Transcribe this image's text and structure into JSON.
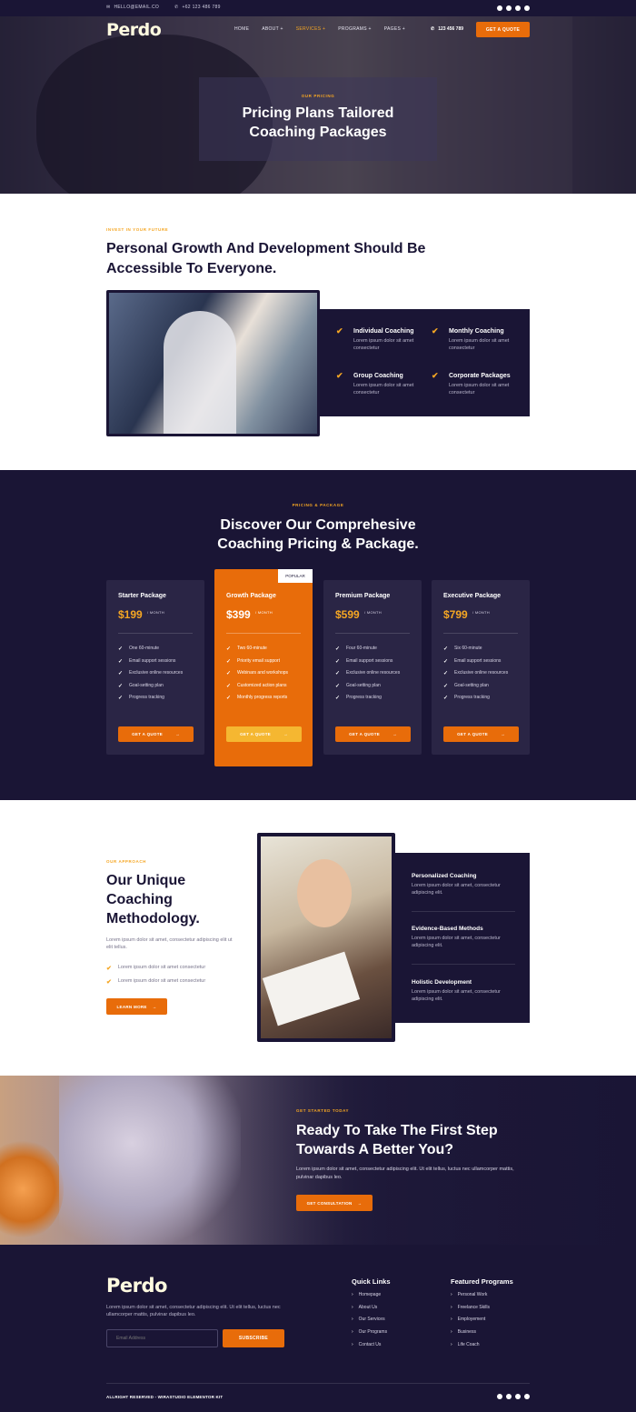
{
  "topbar": {
    "email": "HELLO@EMAIL.CO",
    "phone": "+62 123 486 789",
    "social_icons": [
      "facebook-icon",
      "twitter-icon",
      "youtube-icon",
      "pinterest-icon"
    ]
  },
  "nav": {
    "logo": "Perdo",
    "menu": [
      "HOME",
      "ABOUT +",
      "SERVICES +",
      "PROGRAMS +",
      "PAGES +"
    ],
    "active_index": 2,
    "phone": "123 456 789",
    "cta": "GET A QUOTE"
  },
  "hero": {
    "eyebrow": "OUR PRICING",
    "title_line1": "Pricing Plans Tailored",
    "title_line2": "Coaching Packages"
  },
  "intro": {
    "eyebrow": "INVEST IN YOUR FUTURE",
    "title": "Personal Growth And Development Should Be Accessible To Everyone.",
    "features": [
      {
        "title": "Individual Coaching",
        "text": "Lorem ipsum dolor sit amet consectetur"
      },
      {
        "title": "Monthly Coaching",
        "text": "Lorem ipsum dolor sit amet consectetur"
      },
      {
        "title": "Group Coaching",
        "text": "Lorem ipsum dolor sit amet consectetur"
      },
      {
        "title": "Corporate Packages",
        "text": "Lorem ipsum dolor sit amet consectetur"
      }
    ]
  },
  "pricing": {
    "eyebrow": "PRICING & PACKAGE",
    "title_line1": "Discover Our Comprehesive",
    "title_line2": "Coaching Pricing & Package.",
    "per": "/ MONTH",
    "badge": "POPULAR",
    "button": "GET A QUOTE",
    "plans": [
      {
        "name": "Starter Package",
        "price": "$199",
        "features": [
          "One 60-minute",
          "Email support sessions",
          "Exclusive online resources",
          "Goal-setting plan",
          "Progress tracking"
        ]
      },
      {
        "name": "Growth Package",
        "price": "$399",
        "features": [
          "Two 60-minute",
          "Priority email support",
          "Webinars and workshops",
          "Customized action plans",
          "Monthly progress reports"
        ]
      },
      {
        "name": "Premium Package",
        "price": "$599",
        "features": [
          "Four 60-minute",
          "Email support sessions",
          "Exclusive online resources",
          "Goal-setting plan",
          "Progress tracking"
        ]
      },
      {
        "name": "Executive Package",
        "price": "$799",
        "features": [
          "Six 60-minute",
          "Email support sessions",
          "Exclusive online resources",
          "Goal-setting plan",
          "Progress tracking"
        ]
      }
    ]
  },
  "method": {
    "eyebrow": "OUR APPROACH",
    "title": "Our Unique Coaching Methodology.",
    "desc": "Lorem ipsum dolor sit amet, consectetur adipiscing elit ut elit tellus.",
    "bullets": [
      "Lorem ipsum dolor sit amet consectetur",
      "Lorem ipsum dolor sit amet consectetur"
    ],
    "button": "LEARN MORE",
    "items": [
      {
        "title": "Personalized Coaching",
        "text": "Lorem ipsum dolor sit amet, consectetur adipiscing elit."
      },
      {
        "title": "Evidence-Based Methods",
        "text": "Lorem ipsum dolor sit amet, consectetur adipiscing elit."
      },
      {
        "title": "Holistic Development",
        "text": "Lorem ipsum dolor sit amet, consectetur adipiscing elit."
      }
    ]
  },
  "cta": {
    "eyebrow": "GET STARTED TODAY",
    "title": "Ready To Take The First Step Towards A Better You?",
    "text": "Lorem ipsum dolor sit amet, consectetur adipiscing elit. Ut elit tellus, luctus nec ullamcorper mattis, pulvinar dapibus leo.",
    "button": "GET CONSULTATION"
  },
  "footer": {
    "logo": "Perdo",
    "desc": "Lorem ipsum dolor sit amet, consectetur adipiscing elit. Ut elit tellus, luctus nec ullamcorper mattis, pulvinar dapibus leo.",
    "email_placeholder": "Email Address",
    "subscribe": "SUBSCRIBE",
    "quick_links_title": "Quick Links",
    "quick_links": [
      "Homepage",
      "About Us",
      "Our Services",
      "Our Programs",
      "Contact Us"
    ],
    "programs_title": "Featured Programs",
    "programs": [
      "Personal Work",
      "Freelance Skills",
      "Employement",
      "Business",
      "Life Coach"
    ],
    "copyright": "ALLRIGHT RESERVED - WIRASTUDIO ELEMENTOR KIT"
  },
  "colors": {
    "navy": "#1a1535",
    "accent": "#e86c0a",
    "gold": "#f5a623"
  }
}
